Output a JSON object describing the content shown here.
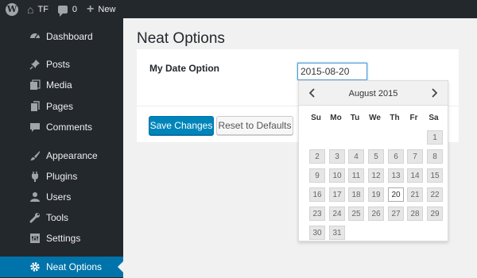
{
  "admin_bar": {
    "site_name": "TF",
    "comments_count": "0",
    "new_label": "New"
  },
  "sidebar": {
    "items": [
      {
        "label": "Dashboard",
        "icon": "dashboard-icon"
      },
      {
        "label": "Posts",
        "icon": "pushpin-icon"
      },
      {
        "label": "Media",
        "icon": "media-icon"
      },
      {
        "label": "Pages",
        "icon": "pages-icon"
      },
      {
        "label": "Comments",
        "icon": "comment-icon"
      },
      {
        "label": "Appearance",
        "icon": "paintbrush-icon"
      },
      {
        "label": "Plugins",
        "icon": "plug-icon"
      },
      {
        "label": "Users",
        "icon": "user-icon"
      },
      {
        "label": "Tools",
        "icon": "wrench-icon"
      },
      {
        "label": "Settings",
        "icon": "settings-icon"
      },
      {
        "label": "Neat Options",
        "icon": "gear-icon",
        "current": true
      }
    ]
  },
  "page": {
    "title": "Neat Options",
    "option_label": "My Date Option",
    "date_value": "2015-08-20",
    "save_label": "Save Changes",
    "reset_label": "Reset to Defaults"
  },
  "datepicker": {
    "month_title": "August 2015",
    "prev_icon": "chevron-left-icon",
    "next_icon": "chevron-right-icon",
    "weekdays": [
      "Su",
      "Mo",
      "Tu",
      "We",
      "Th",
      "Fr",
      "Sa"
    ],
    "first_weekday_index": 6,
    "days_in_month": 31,
    "selected_day": 20
  },
  "colors": {
    "admin_dark": "#23282d",
    "accent": "#0073aa",
    "button_primary": "#0085ba"
  }
}
